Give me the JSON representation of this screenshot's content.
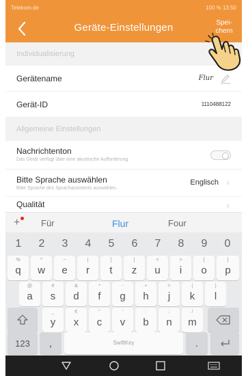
{
  "status_bar": {
    "carrier": "Telekom.de",
    "right_text": "100 %  13:50"
  },
  "header": {
    "title": "Geräte-Einstellungen",
    "back_icon": "chevron-left-icon",
    "save_line1": "Spei-",
    "save_line2": "chern"
  },
  "sections": {
    "individualisierung": "Individualisierung",
    "allgemeine": "Allgemeine Einstellungen"
  },
  "rows": {
    "geraetename": {
      "label": "Gerätename",
      "value": "Flur"
    },
    "geraet_id": {
      "label": "Gerät-ID",
      "value": "1110488122"
    },
    "nachrichtenton": {
      "label": "Nachrichtenton",
      "sub": "Das Gerät verfügt über eine akustische Aufforderung"
    },
    "sprache": {
      "label": "Bitte Sprache auswählen",
      "sub": "Bitte Sprache des Sprachassistents auswählen.",
      "value": "Englisch"
    },
    "qualitaet": {
      "label": "Qualität"
    }
  },
  "suggestions": {
    "plus": "+",
    "left": "Für",
    "center": "Flur",
    "right": "Four"
  },
  "keyboard": {
    "numbers": [
      "1",
      "2",
      "3",
      "4",
      "5",
      "6",
      "7",
      "8",
      "9",
      "0"
    ],
    "row1": [
      {
        "ch": "q",
        "sym": "%"
      },
      {
        "ch": "w",
        "sym": "^"
      },
      {
        "ch": "e",
        "sym": "~"
      },
      {
        "ch": "r",
        "sym": "|"
      },
      {
        "ch": "t",
        "sym": "["
      },
      {
        "ch": "z",
        "sym": "]"
      },
      {
        "ch": "u",
        "sym": "<"
      },
      {
        "ch": "i",
        "sym": ">"
      },
      {
        "ch": "o",
        "sym": "{"
      },
      {
        "ch": "p",
        "sym": "}"
      }
    ],
    "row2": [
      {
        "ch": "a",
        "sym": "@"
      },
      {
        "ch": "s",
        "sym": "#"
      },
      {
        "ch": "d",
        "sym": "&"
      },
      {
        "ch": "f",
        "sym": "*"
      },
      {
        "ch": "g",
        "sym": "-"
      },
      {
        "ch": "h",
        "sym": "+"
      },
      {
        "ch": "j",
        "sym": "="
      },
      {
        "ch": "k",
        "sym": "("
      },
      {
        "ch": "l",
        "sym": ")"
      }
    ],
    "row3": [
      {
        "ch": "y",
        "sym": "_"
      },
      {
        "ch": "x",
        "sym": "€"
      },
      {
        "ch": "c",
        "sym": "\""
      },
      {
        "ch": "v",
        "sym": "'"
      },
      {
        "ch": "b",
        "sym": ":"
      },
      {
        "ch": "n",
        "sym": ";"
      },
      {
        "ch": "m",
        "sym": "/"
      }
    ],
    "key_123": "123",
    "comma": ",",
    "period": ".",
    "space_label": "SwiftKey",
    "shift_icon": "shift-icon",
    "backspace_icon": "backspace-icon",
    "enter_icon": "enter-icon"
  },
  "navbar": {
    "icons": [
      "back-triangle-icon",
      "home-circle-icon",
      "recents-square-icon",
      "keyboard-icon"
    ]
  },
  "colors": {
    "accent": "#f0943a",
    "link_blue": "#3f8ee0"
  }
}
